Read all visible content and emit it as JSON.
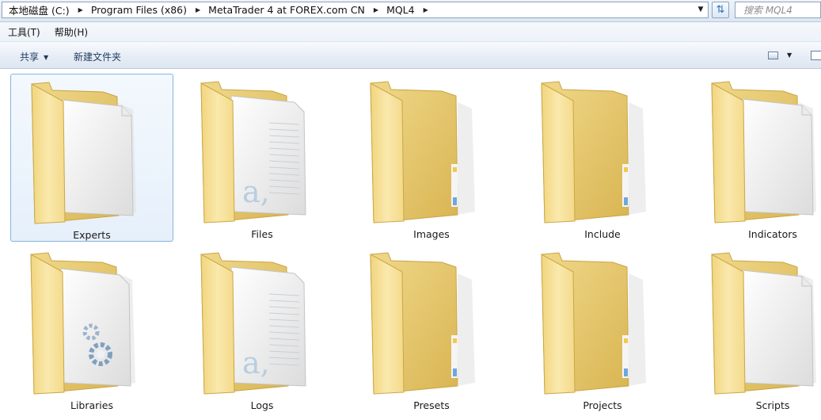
{
  "address_bar": {
    "crumbs": [
      "本地磁盘 (C:)",
      "Program Files (x86)",
      "MetaTrader 4 at FOREX.com CN",
      "MQL4"
    ],
    "search_placeholder": "搜索 MQL4"
  },
  "menu": {
    "items": [
      "工具(T)",
      "帮助(H)"
    ]
  },
  "toolbar": {
    "share_label": "共享",
    "new_folder_label": "新建文件夹"
  },
  "folders": [
    {
      "name": "Experts",
      "content": "document",
      "selected": true
    },
    {
      "name": "Files",
      "content": "text"
    },
    {
      "name": "Images",
      "content": "empty"
    },
    {
      "name": "Include",
      "content": "empty"
    },
    {
      "name": "Indicators",
      "content": "document"
    },
    {
      "name": "Libraries",
      "content": "gear"
    },
    {
      "name": "Logs",
      "content": "text"
    },
    {
      "name": "Presets",
      "content": "empty"
    },
    {
      "name": "Projects",
      "content": "empty"
    },
    {
      "name": "Scripts",
      "content": "document"
    }
  ],
  "colors": {
    "folder_back": "#e2c15f",
    "folder_front": "#f6dd8f",
    "selection_border": "#86b4e0",
    "selection_fill": "#e6f0fb"
  }
}
